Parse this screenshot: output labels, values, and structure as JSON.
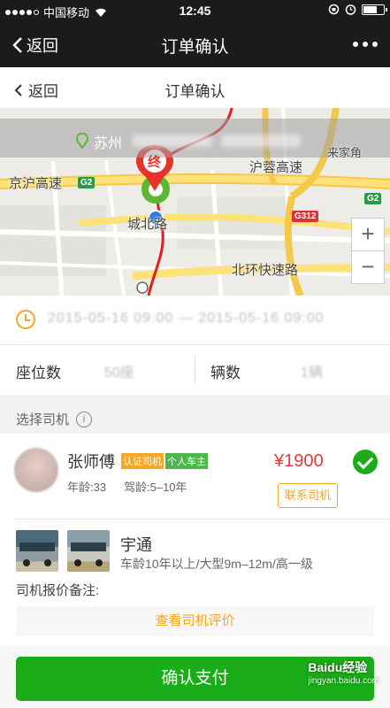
{
  "status_bar": {
    "carrier": "中国移动",
    "time": "12:45"
  },
  "wechat_bar": {
    "back_label": "返回",
    "title": "订单确认"
  },
  "page_header": {
    "back_label": "返回",
    "title": "订单确认"
  },
  "map": {
    "address": "苏州",
    "labels": {
      "road_hujinghuning": "京沪高速",
      "road_hurong": "沪蓉高速",
      "road_chengbei": "城北路",
      "road_beihuan": "北环快速路",
      "place": "来家角",
      "badge_g2_left": "G2",
      "badge_g2_right": "G2",
      "badge_g312": "G312",
      "dest_marker": "终"
    },
    "zoom_in": "+",
    "zoom_out": "−"
  },
  "order": {
    "time_value": "2015-05-16 09:00 — 2015-05-16 09:00",
    "seats_label": "座位数",
    "seats_value": "50座",
    "vehicles_label": "辆数",
    "vehicles_value": "1辆"
  },
  "driver_section": {
    "title": "选择司机",
    "info_icon": "i"
  },
  "driver": {
    "name": "张师傅",
    "tag_certified": "认证司机",
    "tag_owner": "个人车主",
    "age": "年龄:33",
    "experience": "驾龄:5–10年",
    "price": "¥1900",
    "contact_label": "联系司机",
    "vehicle_brand": "宇通",
    "vehicle_desc": "车龄10年以上/大型9m–12m/高一级",
    "remark_label": "司机报价备注:",
    "reviews_label": "查看司机评价"
  },
  "footer": {
    "pay_label": "确认支付",
    "watermark": "Baidu经验",
    "watermark_url": "jingyan.baidu.com"
  },
  "colors": {
    "accent_green": "#1aad19",
    "accent_orange": "#f5a623",
    "price_red": "#e83a3a"
  }
}
